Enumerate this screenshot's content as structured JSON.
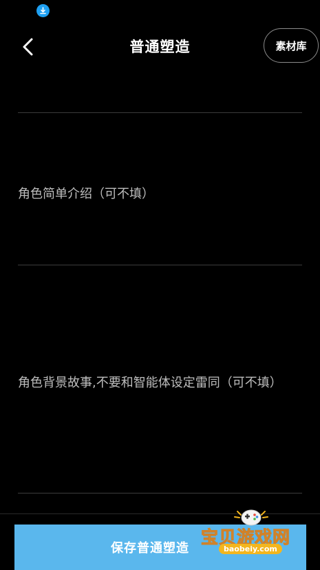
{
  "status_bar": {
    "download_icon": "download-circle-icon",
    "download_color": "#1ea0f2"
  },
  "header": {
    "back_icon": "chevron-left-icon",
    "title": "普通塑造",
    "material_library_label": "素材库"
  },
  "form": {
    "intro_placeholder": "角色简单介绍（可不填）",
    "background_placeholder": "角色背景故事,不要和智能体设定雷同（可不填）"
  },
  "footer": {
    "save_label": "保存普通塑造",
    "save_color": "#5ab7ed"
  },
  "watermark": {
    "title": "宝贝游戏网",
    "url": "baobeiy.com",
    "icon": "gamepad-mascot-icon"
  }
}
